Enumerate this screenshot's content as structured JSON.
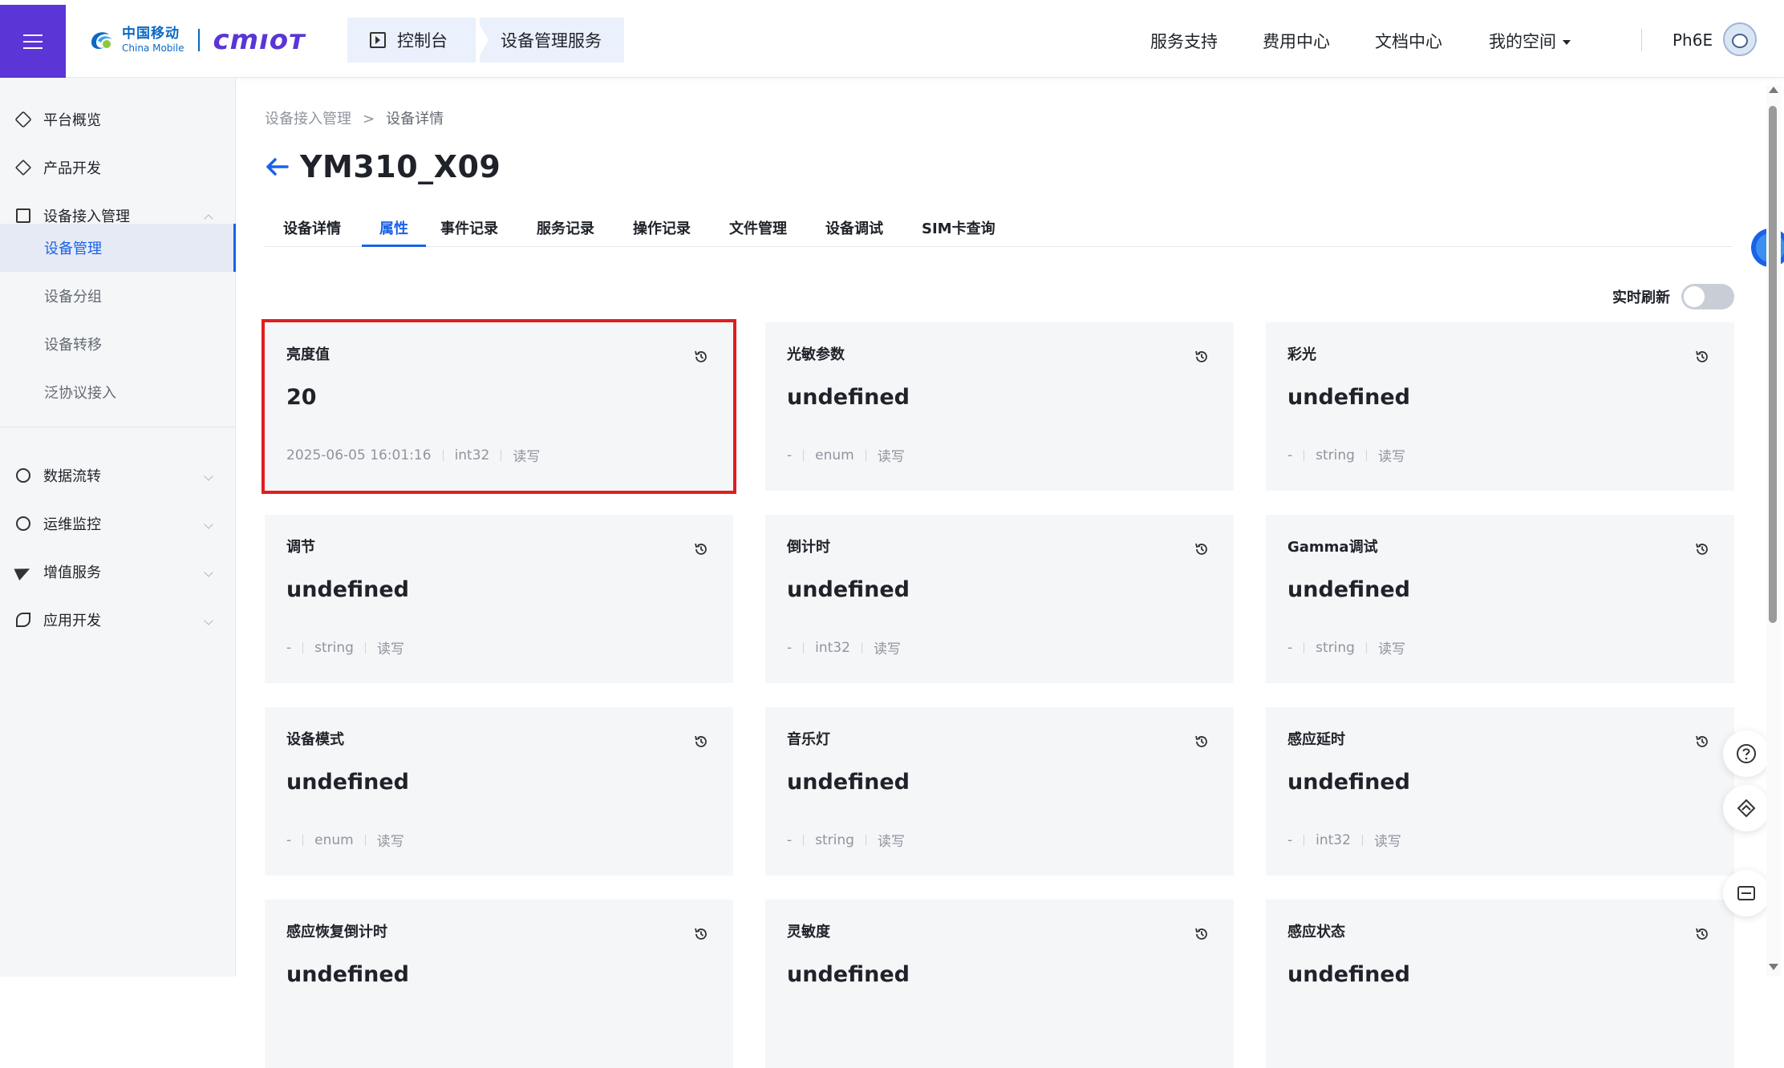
{
  "header": {
    "brand_cn": "中国移动",
    "brand_en": "China Mobile",
    "product_logo": "cmıoт",
    "console_label": "控制台",
    "service_label": "设备管理服务",
    "nav": [
      "服务支持",
      "费用中心",
      "文档中心",
      "我的空间"
    ],
    "username": "Ph6E"
  },
  "sidebar": {
    "items": [
      {
        "label": "平台概览",
        "icon": "overview-icon"
      },
      {
        "label": "产品开发",
        "icon": "cube-icon"
      },
      {
        "label": "设备接入管理",
        "icon": "device-access-icon"
      },
      {
        "label": "数据流转",
        "icon": "data-flow-icon"
      },
      {
        "label": "运维监控",
        "icon": "monitor-icon"
      },
      {
        "label": "增值服务",
        "icon": "send-icon"
      },
      {
        "label": "应用开发",
        "icon": "app-dev-icon"
      }
    ],
    "subitems": [
      "设备管理",
      "设备分组",
      "设备转移",
      "泛协议接入"
    ]
  },
  "breadcrumb": {
    "parent": "设备接入管理",
    "sep": ">",
    "current": "设备详情"
  },
  "page_title": "YM310_X09",
  "tabs": [
    "设备详情",
    "属性",
    "事件记录",
    "服务记录",
    "操作记录",
    "文件管理",
    "设备调试",
    "SIM卡查询"
  ],
  "active_tab": "属性",
  "realtime_refresh": {
    "label": "实时刷新",
    "on": false
  },
  "properties": [
    {
      "name": "亮度值",
      "value": "20",
      "time": "2025-06-05 16:01:16",
      "type": "int32",
      "access": "读写"
    },
    {
      "name": "光敏参数",
      "value": "undefined",
      "time": "-",
      "type": "enum",
      "access": "读写"
    },
    {
      "name": "彩光",
      "value": "undefined",
      "time": "-",
      "type": "string",
      "access": "读写"
    },
    {
      "name": "调节",
      "value": "undefined",
      "time": "-",
      "type": "string",
      "access": "读写"
    },
    {
      "name": "倒计时",
      "value": "undefined",
      "time": "-",
      "type": "int32",
      "access": "读写"
    },
    {
      "name": "Gamma调试",
      "value": "undefined",
      "time": "-",
      "type": "string",
      "access": "读写"
    },
    {
      "name": "设备模式",
      "value": "undefined",
      "time": "-",
      "type": "enum",
      "access": "读写"
    },
    {
      "name": "音乐灯",
      "value": "undefined",
      "time": "-",
      "type": "string",
      "access": "读写"
    },
    {
      "name": "感应延时",
      "value": "undefined",
      "time": "-",
      "type": "int32",
      "access": "读写"
    },
    {
      "name": "感应恢复倒计时",
      "value": "undefined",
      "time": "",
      "type": "",
      "access": ""
    },
    {
      "name": "灵敏度",
      "value": "undefined",
      "time": "",
      "type": "",
      "access": ""
    },
    {
      "name": "感应状态",
      "value": "undefined",
      "time": "",
      "type": "",
      "access": ""
    }
  ],
  "colors": {
    "brand_purple": "#5b35d5",
    "accent_blue": "#1a62e8",
    "highlight_red": "#e01e1e"
  }
}
